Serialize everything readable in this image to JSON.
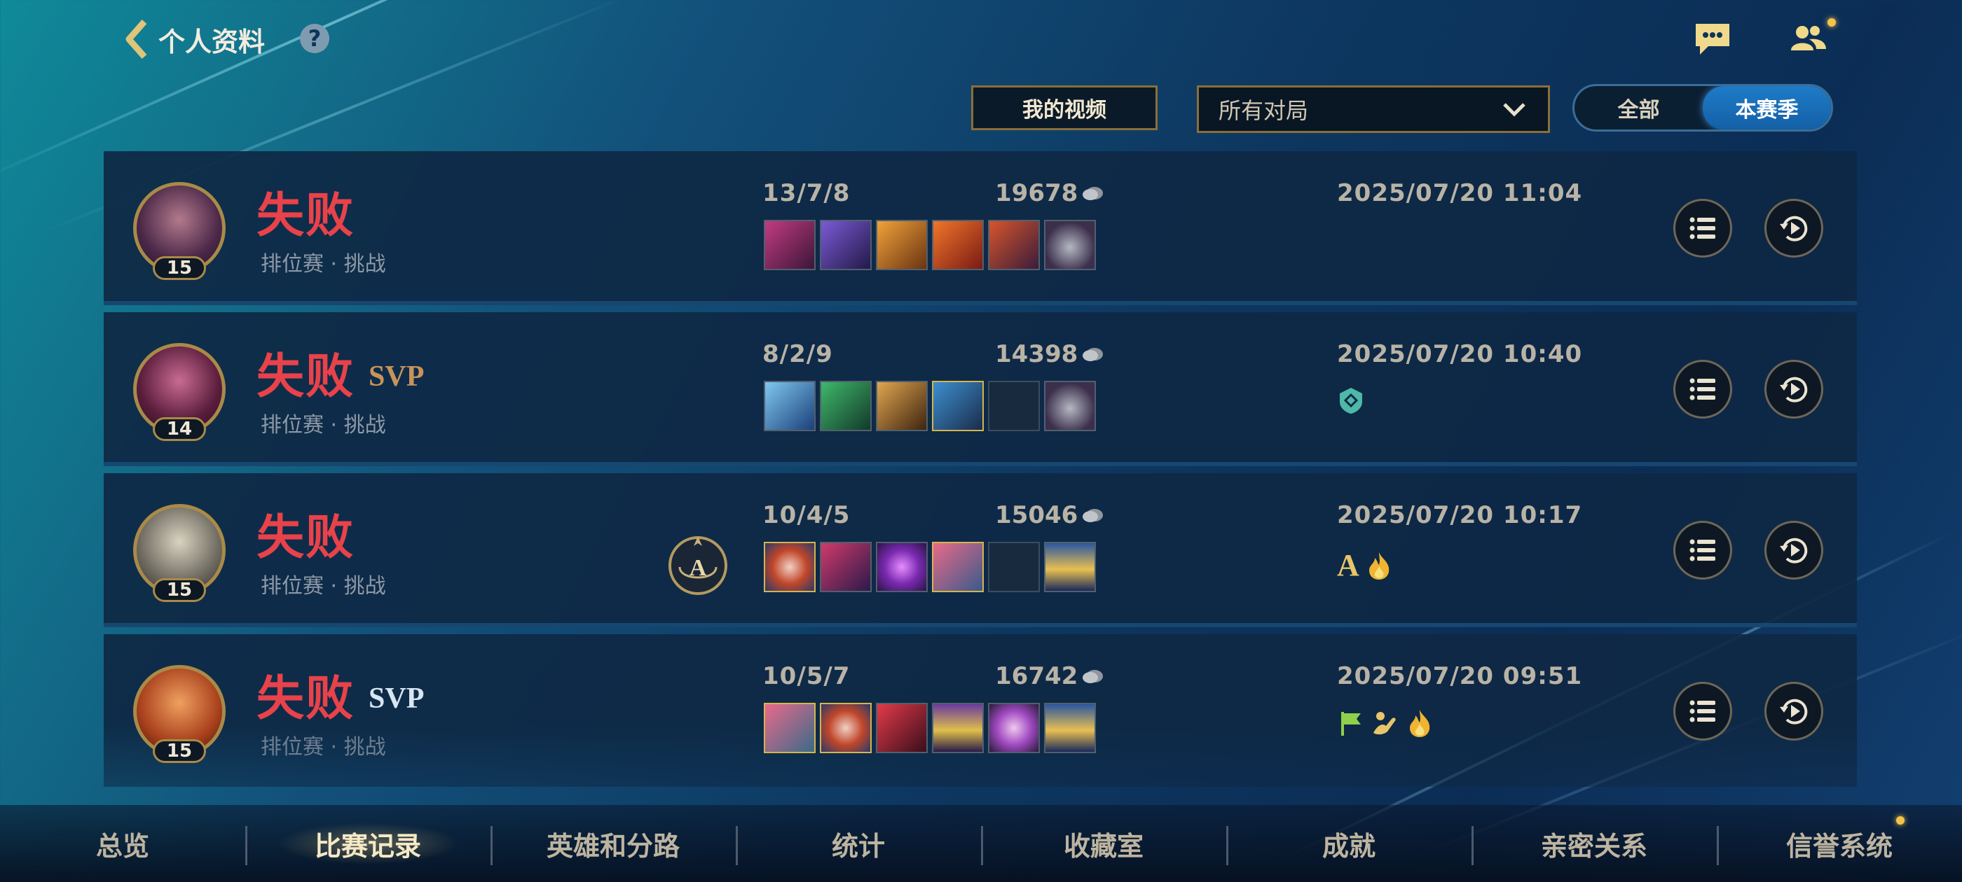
{
  "header": {
    "title": "个人资料",
    "help_icon": "?"
  },
  "controls": {
    "my_video": "我的视频",
    "filter_selected": "所有对局",
    "toggle": [
      "全部",
      "本赛季"
    ],
    "toggle_active": "本赛季"
  },
  "matches": [
    {
      "result": "失败",
      "svp": "",
      "mode": "排位赛 · 挑战",
      "level": "15",
      "kda": "13/7/8",
      "gold": "19678",
      "date": "2025/07/20 11:04"
    },
    {
      "result": "失败",
      "svp": "SVP",
      "mode": "排位赛 · 挑战",
      "level": "14",
      "kda": "8/2/9",
      "gold": "14398",
      "date": "2025/07/20 10:40"
    },
    {
      "result": "失败",
      "svp": "",
      "mode": "排位赛 · 挑战",
      "level": "15",
      "kda": "10/4/5",
      "gold": "15046",
      "date": "2025/07/20 10:17",
      "badge_letter": "A"
    },
    {
      "result": "失败",
      "svp": "SVP",
      "mode": "排位赛 · 挑战",
      "level": "15",
      "kda": "10/5/7",
      "gold": "16742",
      "date": "2025/07/20 09:51"
    }
  ],
  "tabs": [
    "总览",
    "比赛记录",
    "英雄和分路",
    "统计",
    "收藏室",
    "成就",
    "亲密关系",
    "信誉系统"
  ],
  "active_tab": "比赛记录",
  "colors": {
    "defeat": "#e8424a",
    "svp_bronze": "#c9925a",
    "svp_silver": "#d7e6f2",
    "accent_gold": "#a98a48",
    "toggle_active": "#1f7bc8"
  }
}
